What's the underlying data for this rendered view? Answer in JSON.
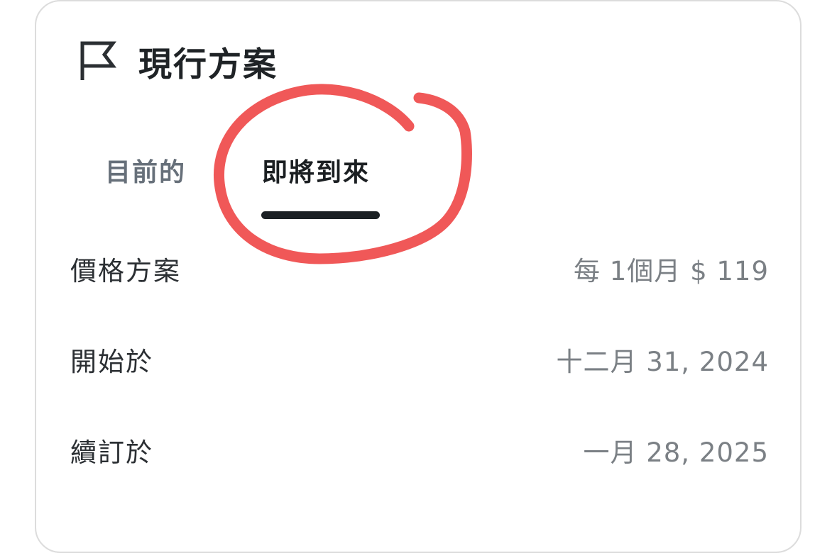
{
  "plan_card": {
    "title": "現行方案",
    "header_icon": "flag-icon",
    "tabs": [
      {
        "label": "目前的",
        "selected": false
      },
      {
        "label": "即將到來",
        "selected": true
      }
    ],
    "rows": [
      {
        "label": "價格方案",
        "value": "每 1個月 $ 119"
      },
      {
        "label": "開始於",
        "value": "十二月 31, 2024"
      },
      {
        "label": "續訂於",
        "value": "一月 28, 2025"
      }
    ]
  },
  "colors": {
    "title_text": "#1f2326",
    "tab_inactive": "#67707a",
    "tab_active": "#1b1f22",
    "tab_indicator": "#1b2024",
    "label_text": "#2b2f33",
    "value_text": "#7b8085",
    "card_border": "#dcdcdc",
    "annotation_stroke": "#ef4a4a"
  }
}
